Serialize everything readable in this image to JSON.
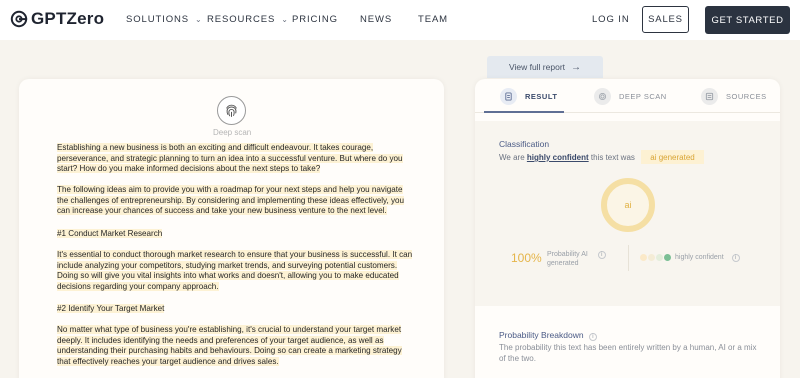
{
  "nav": {
    "brand": "GPTZero",
    "items": [
      "SOLUTIONS",
      "RESOURCES",
      "PRICING",
      "NEWS",
      "TEAM"
    ],
    "login": "LOG IN",
    "sales": "SALES",
    "cta": "GET STARTED"
  },
  "document": {
    "scan_label": "Deep scan",
    "paragraphs": [
      [
        "Establishing a new business is both an exciting and difficult endeavour. It takes courage,",
        "perseverance, and strategic planning to turn an idea into a successful venture. But where do you",
        "start? How do you make informed decisions about the next steps to take?"
      ],
      [
        "The following ideas aim to provide you with a roadmap for your next steps and help you navigate",
        "the challenges of entrepreneurship. By considering and implementing these ideas effectively, you",
        "can increase your chances of success and take your new business venture to the next level."
      ],
      [
        "#1 Conduct Market Research"
      ],
      [
        "It's essential to conduct thorough market research to ensure that your business is successful. It can",
        "include analyzing your competitors, studying market trends, and surveying potential customers.",
        "Doing so will give you vital insights into what works and doesn't, allowing you to make educated",
        "decisions regarding your company approach."
      ],
      [
        "#2 Identify Your Target Market"
      ],
      [
        "No matter what type of business you're establishing, it's crucial to understand your target market",
        "deeply. It includes identifying the needs and preferences of your target audience, as well as",
        "understanding their purchasing habits and behaviours. Doing so can create a marketing strategy",
        "that effectively reaches your target audience and drives sales."
      ]
    ]
  },
  "report": {
    "view_full": "View full report",
    "tabs": [
      "RESULT",
      "DEEP SCAN",
      "SOURCES"
    ],
    "classification": {
      "title": "Classification",
      "prefix": "We are",
      "confidence": "highly confident",
      "middle": "this text was",
      "badge": "ai generated",
      "donut": "ai",
      "percent": "100%",
      "percent_label_1": "Probability AI",
      "percent_label_2": "generated",
      "confidence_label": "highly confident"
    },
    "breakdown": {
      "title": "Probability Breakdown",
      "desc": "The probability this text has been entirely written by a human, AI or a mix of the two."
    }
  },
  "colors": {
    "highlight": "#fdf2d4",
    "accent": "#e5b54a",
    "nav_dark": "#2b3340",
    "link": "#3b4a6b"
  }
}
